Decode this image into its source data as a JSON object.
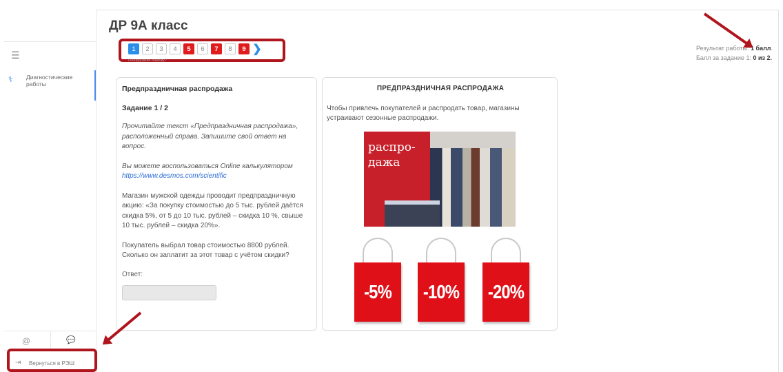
{
  "header": {
    "title": "ДР 9А класс",
    "found_error": "Обнаружили ошибку?"
  },
  "pager": {
    "pages": [
      "1",
      "2",
      "3",
      "4",
      "5",
      "6",
      "7",
      "8",
      "9"
    ],
    "current": "1",
    "error_pages": [
      "5",
      "7",
      "9"
    ],
    "next_icon": "chevron-right-icon"
  },
  "result": {
    "line1_label": "Результат работы: ",
    "line1_value": "1 балл",
    "line1_suffix": ".",
    "line2_label": "Балл за задание 1: ",
    "line2_value": "0 из 2."
  },
  "sidebar": {
    "menu_icon": "hamburger-icon",
    "item_label": "Диагностические работы",
    "back_label": "Вернуться в РЭШ"
  },
  "task": {
    "title": "Предпраздничная распродажа",
    "number": "Задание 1 / 2",
    "instruction": "Прочитайте текст «Предпраздничная распродажа», расположенный справа. Запишите свой ответ на вопрос.",
    "calc_text": "Вы можете воспользоваться Online калькулятором ",
    "calc_link": "https://www.desmos.com/scientific",
    "condition": "Магазин мужской одежды проводит предпраздничную акцию: «За покупку стоимостью до 5 тыс. рублей даётся скидка 5%, от 5 до 10 тыс. рублей – скидка 10 %, свыше 10 тыс. рублей – скидка 20%».",
    "question": "Покупатель выбрал товар стоимостью 8800 рублей. Сколько он заплатит за этот товар с учётом скидки?",
    "answer_label": "Ответ:",
    "answer_value": ""
  },
  "text_card": {
    "title": "ПРЕДПРАЗДНИЧНАЯ РАСПРОДАЖА",
    "intro": "Чтобы привлечь покупателей и распродать товар, магазины устраивают сезонные распродажи.",
    "photo_sign": "распро-\nдажа",
    "bags": [
      "-5%",
      "-10%",
      "-20%"
    ]
  },
  "colors": {
    "accent": "#2b8ee8",
    "error": "#e11c1c",
    "highlight": "#b0141c"
  }
}
